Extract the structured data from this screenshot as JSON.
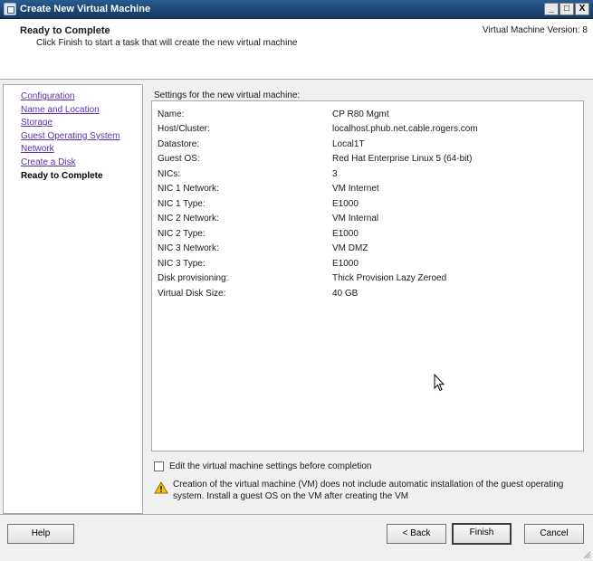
{
  "window": {
    "title": "Create New Virtual Machine",
    "buttons": [
      "_",
      "□",
      "X"
    ]
  },
  "header": {
    "title": "Ready to Complete",
    "subtitle": "Click Finish to start a task that will create the new virtual machine",
    "version": "Virtual Machine Version: 8"
  },
  "steps": [
    {
      "label": "Configuration",
      "state": "link"
    },
    {
      "label": "Name and Location",
      "state": "link"
    },
    {
      "label": "Storage",
      "state": "link"
    },
    {
      "label": "Guest Operating System",
      "state": "link"
    },
    {
      "label": "Network",
      "state": "link"
    },
    {
      "label": "Create a Disk",
      "state": "link"
    },
    {
      "label": "Ready to Complete",
      "state": "current"
    }
  ],
  "settings": {
    "label": "Settings for the new virtual machine:",
    "rows": [
      {
        "key": "Name:",
        "value": "CP R80 Mgmt"
      },
      {
        "key": "Host/Cluster:",
        "value": "localhost.phub.net.cable.rogers.com"
      },
      {
        "key": "Datastore:",
        "value": "Local1T"
      },
      {
        "key": "Guest OS:",
        "value": "Red Hat Enterprise Linux 5 (64-bit)"
      },
      {
        "key": "NICs:",
        "value": "3"
      },
      {
        "key": "NIC 1 Network:",
        "value": "VM Internet"
      },
      {
        "key": "NIC 1 Type:",
        "value": "E1000"
      },
      {
        "key": "NIC 2 Network:",
        "value": "VM Internal"
      },
      {
        "key": "NIC 2 Type:",
        "value": "E1000"
      },
      {
        "key": "NIC 3 Network:",
        "value": "VM DMZ"
      },
      {
        "key": "NIC 3 Type:",
        "value": "E1000"
      },
      {
        "key": "Disk provisioning:",
        "value": "Thick Provision Lazy Zeroed"
      },
      {
        "key": "Virtual Disk Size:",
        "value": "40 GB"
      }
    ]
  },
  "edit_checkbox": {
    "label": "Edit the virtual machine settings before completion",
    "checked": false
  },
  "warning": {
    "icon": "warning-icon",
    "text": "Creation of the virtual machine (VM) does not include automatic installation of the guest operating system. Install a guest OS on the VM after creating the VM"
  },
  "footer": {
    "help": "Help",
    "back": "< Back",
    "finish": "Finish",
    "cancel": "Cancel"
  },
  "colors": {
    "titlebar": "#1c4675",
    "link": "#5a2fb3",
    "warning": "#f5c400"
  }
}
